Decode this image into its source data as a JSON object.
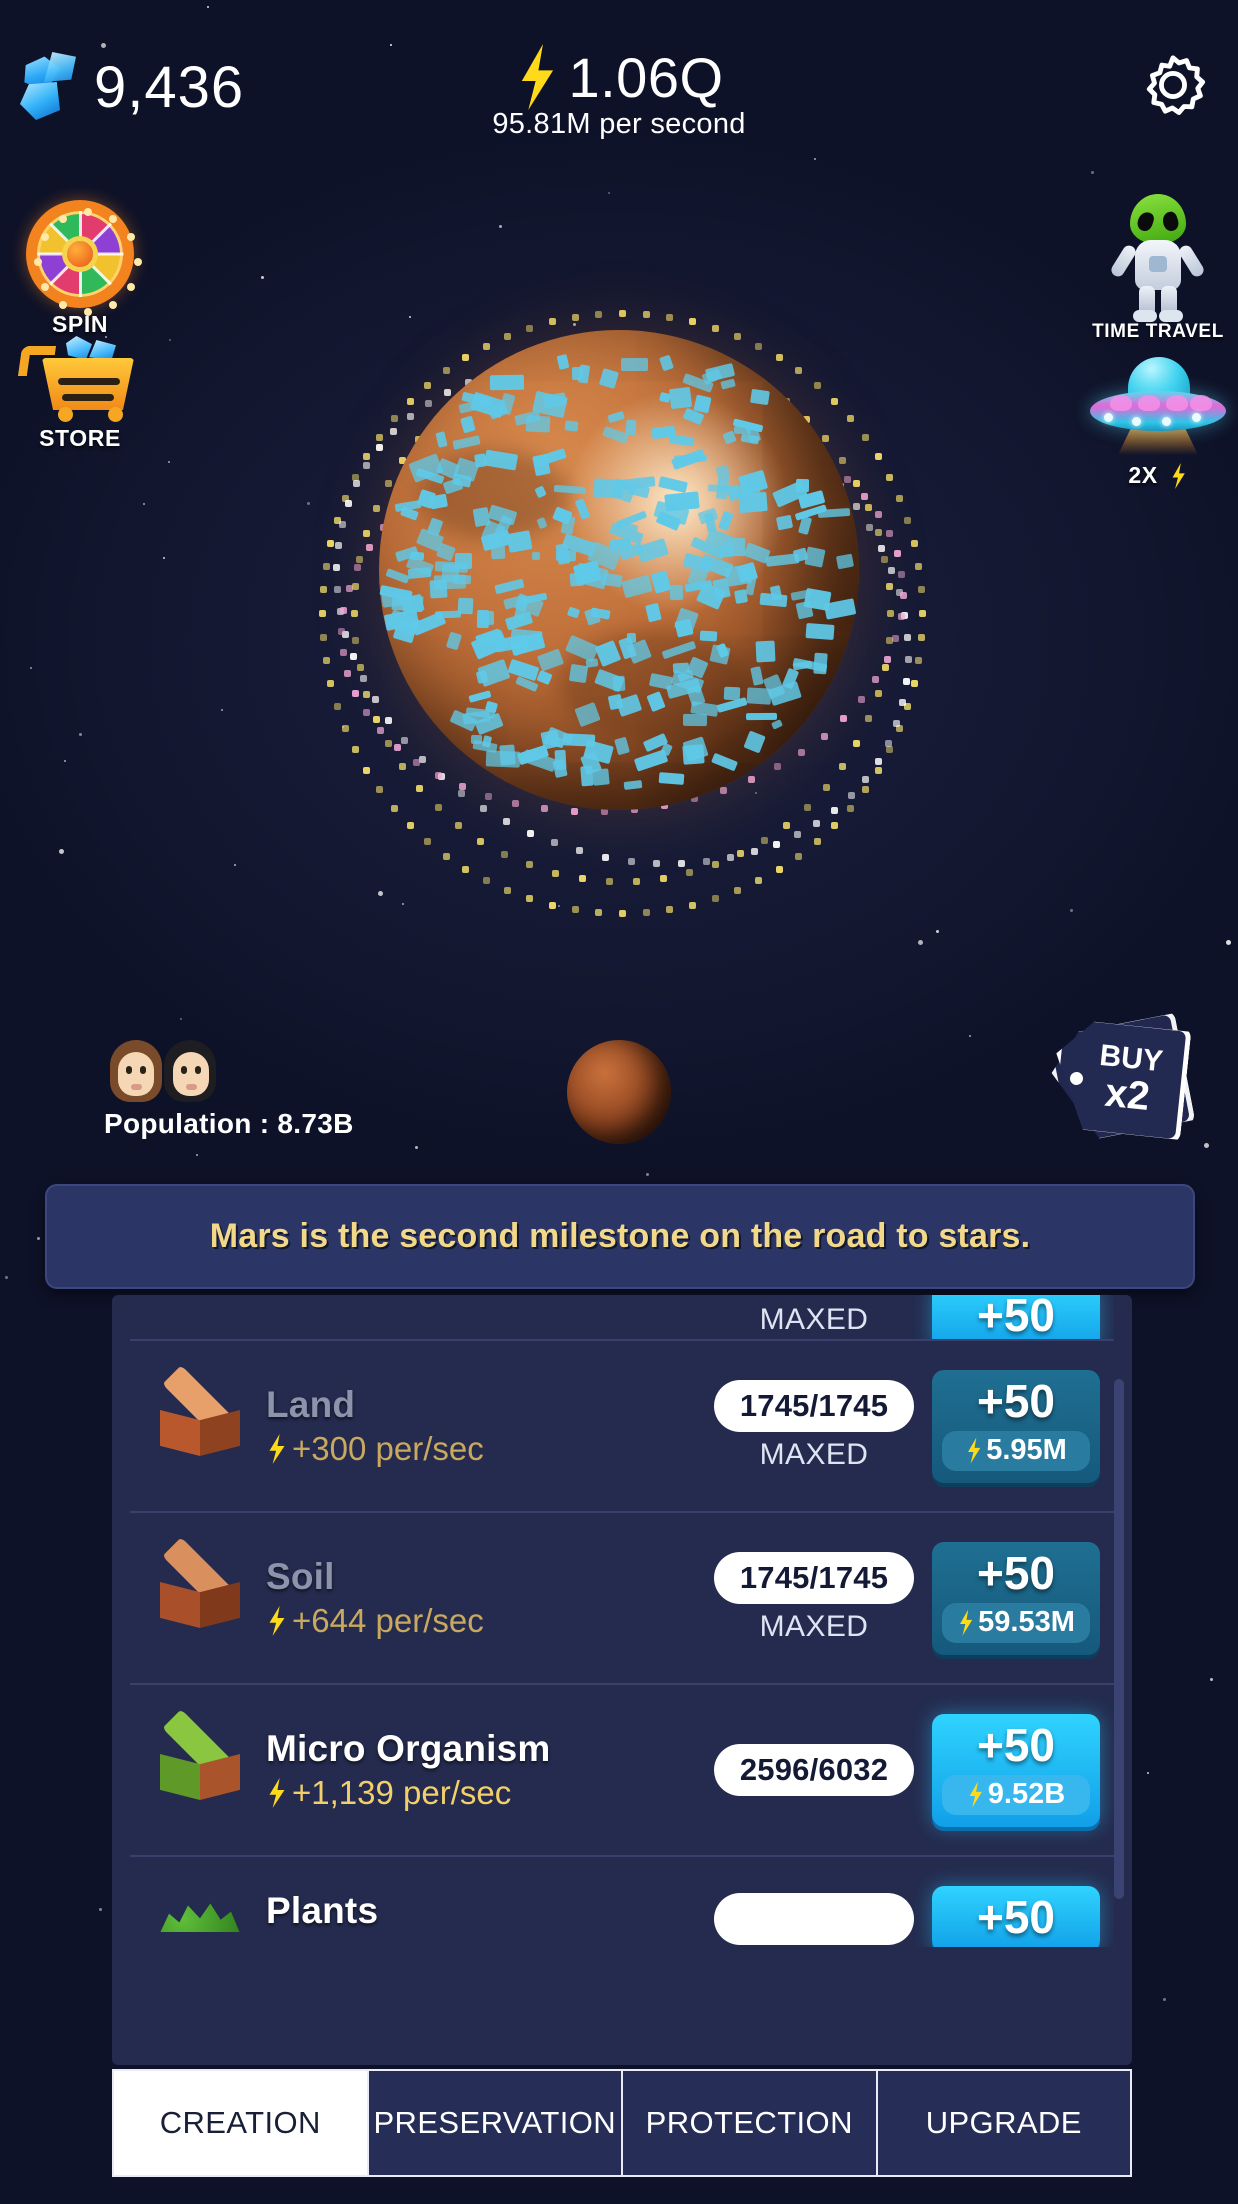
{
  "header": {
    "gems": "9,436",
    "gem_icon": "gem-icon",
    "energy": "1.06Q",
    "energy_rate": "95.81M per second",
    "energy_icon": "lightning-bolt-icon",
    "settings_icon": "gear-icon"
  },
  "left_buttons": [
    {
      "label": "SPIN",
      "icon": "spin-wheel-icon"
    },
    {
      "label": "STORE",
      "icon": "shopping-cart-icon"
    }
  ],
  "right_buttons": [
    {
      "label": "TIME TRAVEL",
      "icon": "alien-astronaut-icon"
    },
    {
      "label": "2X",
      "icon": "ufo-icon"
    }
  ],
  "planet": {
    "name": "mars-planet",
    "moon": "mars-moon"
  },
  "population": {
    "label": "Population : 8.73B",
    "icon": "two-people-icon"
  },
  "buy_badge": {
    "line1": "BUY",
    "line2": "x2",
    "icon": "price-tag-icon"
  },
  "banner": {
    "text": "Mars is the second milestone on the road to stars."
  },
  "upgrades": [
    {
      "name": "Land",
      "rate": "+300 per/sec",
      "count": "1745/1745",
      "status": "MAXED",
      "amount": "+50",
      "cost": "5.95M",
      "maxed": true,
      "icon": "land-block-icon",
      "colors": {
        "top": "#e8a06a",
        "left": "#b9582c",
        "right": "#8e4220"
      }
    },
    {
      "name": "Soil",
      "rate": "+644 per/sec",
      "count": "1745/1745",
      "status": "MAXED",
      "amount": "+50",
      "cost": "59.53M",
      "maxed": true,
      "icon": "soil-block-icon",
      "colors": {
        "top": "#d98f5e",
        "left": "#a9502a",
        "right": "#80391b"
      }
    },
    {
      "name": "Micro Organism",
      "rate": "+1,139 per/sec",
      "count": "2596/6032",
      "status": "",
      "amount": "+50",
      "cost": "9.52B",
      "maxed": false,
      "icon": "micro-organism-block-icon",
      "colors": {
        "top": "#8ac63f",
        "left": "#5f9a28",
        "right": "#a9542a"
      }
    }
  ],
  "partial_top": {
    "status": "MAXED",
    "amount": "+50"
  },
  "partial_bottom": {
    "name": "Plants",
    "amount": "+50",
    "icon": "plants-icon"
  },
  "tabs": [
    {
      "label": "CREATION",
      "active": true
    },
    {
      "label": "PRESERVATION",
      "active": false
    },
    {
      "label": "PROTECTION",
      "active": false
    },
    {
      "label": "UPGRADE",
      "active": false
    }
  ],
  "colors": {
    "accent_cyan": "#2fd3ff",
    "banner_text": "#f2d98a",
    "panel_bg": "#242b4e",
    "space_bg": "#0e1228"
  }
}
